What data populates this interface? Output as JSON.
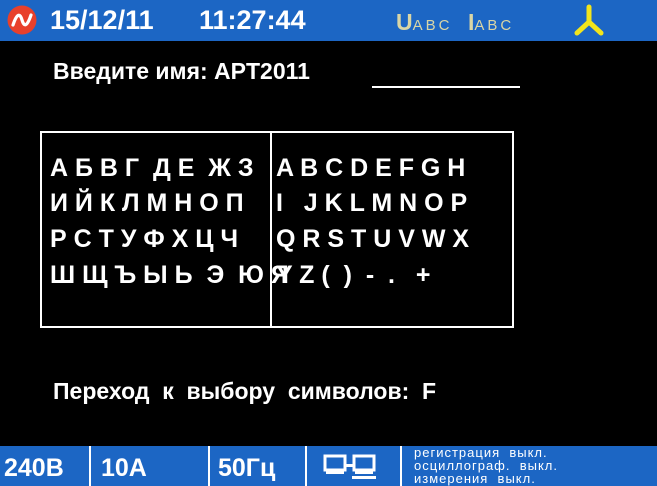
{
  "header": {
    "date": "15/12/11",
    "time": "11:27:44",
    "u_label": "U",
    "u_sub": "ABC",
    "i_label": "I",
    "i_sub": "ABC",
    "logo_icon": "brand-logo-icon",
    "phase_icon": "three-phase-icon",
    "bar_color": "#1c66c4",
    "logo_color": "#e8402b",
    "phase_color": "#f2e51c"
  },
  "name_entry": {
    "prompt": "Введите имя: ",
    "value": "APT2011"
  },
  "char_grid": {
    "cyrillic_rows": [
      "А Б В Г  Д Е  Ж З",
      "И Й К Л М Н О П",
      "Р С Т У Ф Х Ц Ч",
      "Ш Щ Ъ Ы Ь  Э  Ю Я"
    ],
    "latin_rows": [
      "A B C D E F G H",
      "I   J K L M N O P",
      "Q R S T U V W X",
      "Y Z (  )  -  .   +"
    ]
  },
  "hint": "Переход  к  выбору  символов:  F",
  "status": {
    "voltage": "240В",
    "current": "10А",
    "frequency": "50Гц",
    "network_icon": "network-connection-icon",
    "lines": [
      "регистрация  выкл.",
      "осциллограф.  выкл.",
      "измерения  выкл."
    ]
  }
}
